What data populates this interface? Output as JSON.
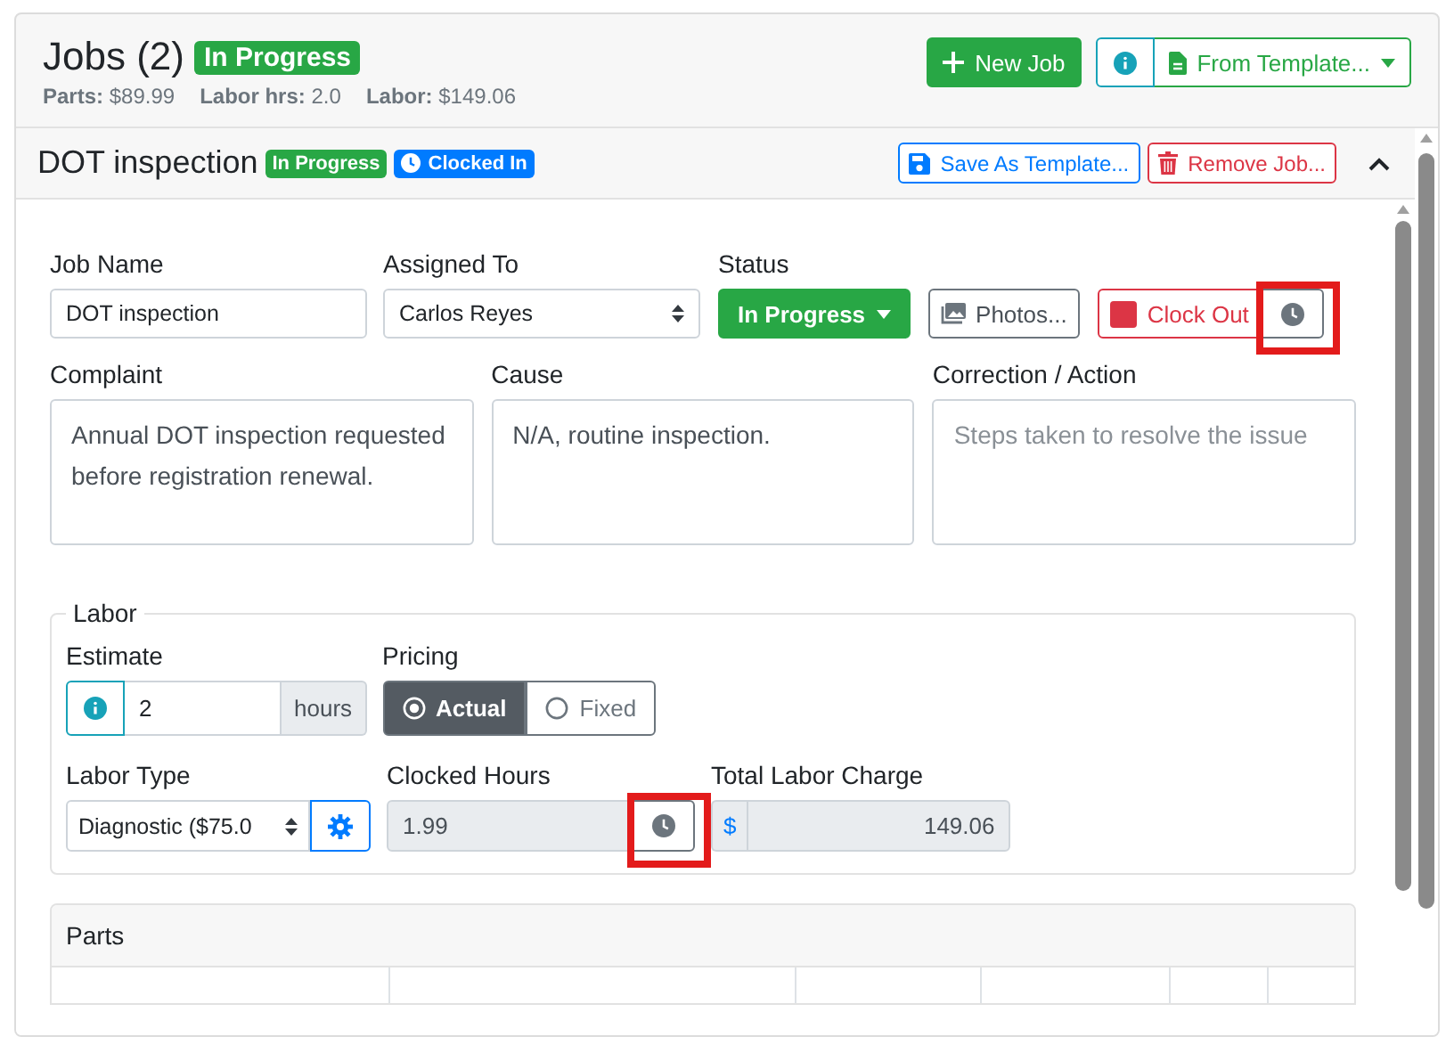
{
  "header": {
    "title": "Jobs (2)",
    "status_badge": "In Progress",
    "stats": [
      {
        "label": "Parts:",
        "value": "$89.99"
      },
      {
        "label": "Labor hrs:",
        "value": "2.0"
      },
      {
        "label": "Labor:",
        "value": "$149.06"
      }
    ],
    "new_job_button": "New Job",
    "from_template_button": "From Template..."
  },
  "job": {
    "title": "DOT inspection",
    "expanded": true,
    "badges": [
      {
        "kind": "status",
        "text": "In Progress"
      },
      {
        "kind": "clock",
        "text": "Clocked In"
      }
    ],
    "save_template_button": "Save As Template...",
    "remove_button": "Remove Job...",
    "job_name": {
      "label": "Job Name",
      "value": "DOT inspection"
    },
    "assigned_to": {
      "label": "Assigned To",
      "value": "Carlos Reyes"
    },
    "status": {
      "label": "Status",
      "value": "In Progress"
    },
    "photos_button": "Photos...",
    "clock_out_button": "Clock Out",
    "clock_history_button": {
      "highlighted": true
    },
    "complaint": {
      "label": "Complaint",
      "value": "Annual DOT inspection requested before registration renewal."
    },
    "cause": {
      "label": "Cause",
      "value": "N/A, routine inspection."
    },
    "correction": {
      "label": "Correction / Action",
      "placeholder": "Steps taken to resolve the issue"
    },
    "labor": {
      "legend": "Labor",
      "estimate": {
        "label": "Estimate",
        "value": "2",
        "unit": "hours"
      },
      "pricing": {
        "label": "Pricing",
        "options": [
          {
            "label": "Actual",
            "selected": true
          },
          {
            "label": "Fixed",
            "selected": false
          }
        ]
      },
      "labor_type": {
        "label": "Labor Type",
        "value": "Diagnostic ($75.0"
      },
      "clocked_hours": {
        "label": "Clocked Hours",
        "value": "1.99",
        "highlighted": true
      },
      "total": {
        "label": "Total Labor Charge",
        "prefix": "$",
        "value": "149.06"
      }
    },
    "parts": {
      "title": "Parts"
    }
  }
}
